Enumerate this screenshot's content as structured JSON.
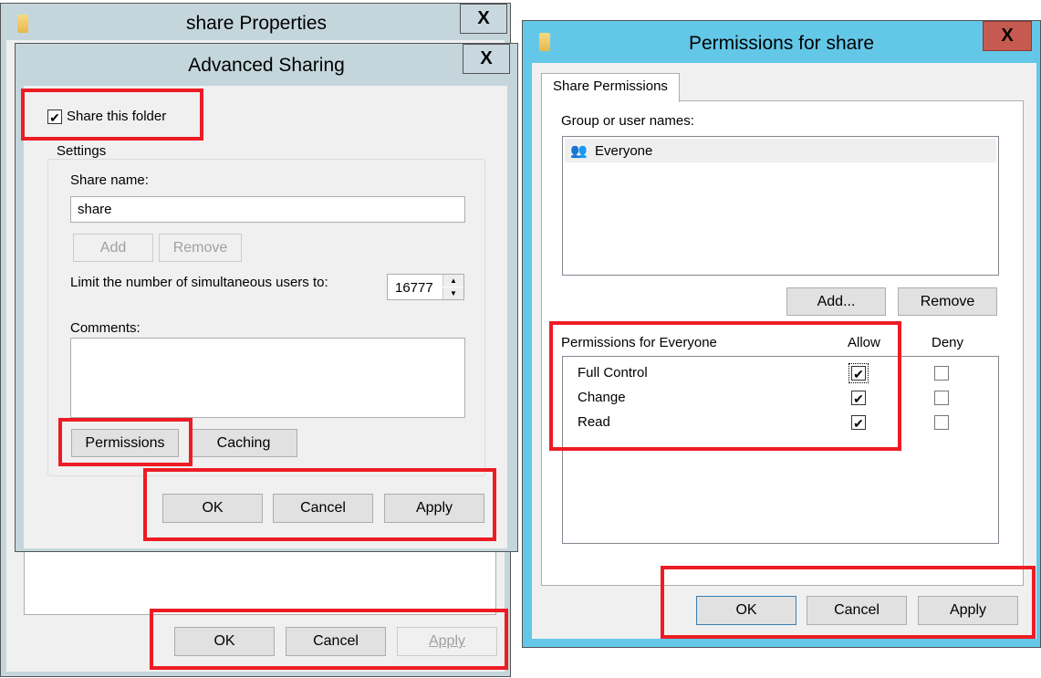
{
  "share_properties": {
    "title": "share Properties",
    "close": "X",
    "buttons": {
      "ok": "OK",
      "cancel": "Cancel",
      "apply": "Apply"
    }
  },
  "advanced_sharing": {
    "title": "Advanced Sharing",
    "close": "X",
    "share_this_folder": "Share this folder",
    "share_checked": true,
    "settings_label": "Settings",
    "share_name_label": "Share name:",
    "share_name_value": "share",
    "add": "Add",
    "remove": "Remove",
    "limit_label": "Limit the number of simultaneous users to:",
    "limit_value": "16777",
    "comments_label": "Comments:",
    "permissions": "Permissions",
    "caching": "Caching",
    "buttons": {
      "ok": "OK",
      "cancel": "Cancel",
      "apply": "Apply"
    }
  },
  "permissions_window": {
    "title": "Permissions for share",
    "close": "X",
    "tab": "Share Permissions",
    "group_label": "Group or user names:",
    "users": [
      "Everyone"
    ],
    "add": "Add...",
    "remove": "Remove",
    "perm_label": "Permissions for Everyone",
    "allow": "Allow",
    "deny": "Deny",
    "permissions": [
      {
        "name": "Full Control",
        "allow": true,
        "deny": false
      },
      {
        "name": "Change",
        "allow": true,
        "deny": false
      },
      {
        "name": "Read",
        "allow": true,
        "deny": false
      }
    ],
    "buttons": {
      "ok": "OK",
      "cancel": "Cancel",
      "apply": "Apply"
    }
  },
  "colors": {
    "highlight": "#ed1c24",
    "active_frame": "#63c8e8",
    "inactive_frame": "#c4d6dc",
    "close_active": "#c75a50"
  }
}
